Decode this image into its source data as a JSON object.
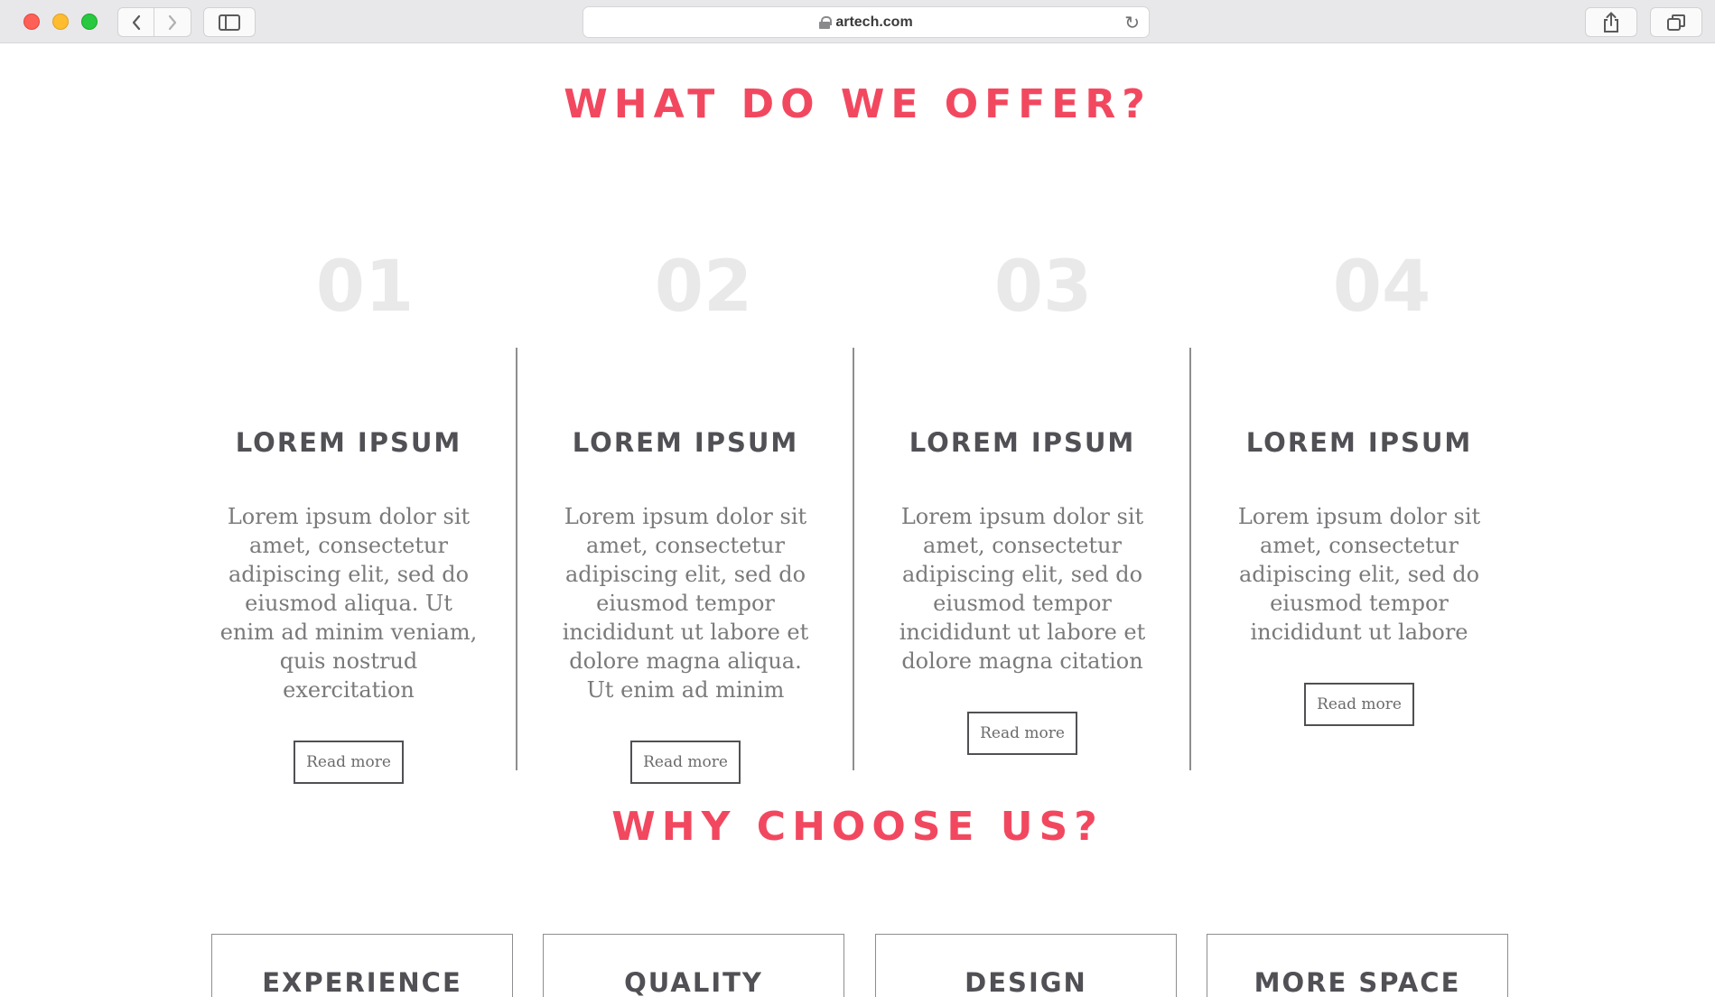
{
  "browser": {
    "url": "artech.com"
  },
  "offer": {
    "title": "WHAT DO WE OFFER?",
    "items": [
      {
        "number": "01",
        "title": "LOREM IPSUM",
        "text": "Lorem ipsum dolor sit amet, consectetur adipiscing elit, sed do eiusmod aliqua. Ut enim ad minim veniam, quis nostrud exercitation",
        "button": "Read more"
      },
      {
        "number": "02",
        "title": "LOREM IPSUM",
        "text": "Lorem ipsum dolor sit amet, consectetur adipiscing elit, sed do eiusmod tempor incididunt ut labore et dolore magna aliqua. Ut enim ad minim",
        "button": "Read more"
      },
      {
        "number": "03",
        "title": "LOREM IPSUM",
        "text": "Lorem ipsum dolor sit amet, consectetur adipiscing elit, sed do eiusmod tempor incididunt ut labore et dolore magna citation",
        "button": "Read more"
      },
      {
        "number": "04",
        "title": "LOREM IPSUM",
        "text": "Lorem ipsum dolor sit amet, consectetur adipiscing elit, sed do eiusmod tempor incididunt ut labore",
        "button": "Read more"
      }
    ]
  },
  "why": {
    "title": "WHY CHOOSE US?",
    "features": [
      "EXPERIENCE",
      "QUALITY",
      "DESIGN",
      "MORE SPACE"
    ]
  },
  "colors": {
    "accent": "#f2485f",
    "heading": "#505055",
    "body_text": "#7a7a7c",
    "number": "#e9e9ea"
  },
  "icons": {
    "back": "chevron-left-icon",
    "forward": "chevron-right-icon",
    "sidebar": "sidebar-icon",
    "lock": "lock-icon",
    "reload": "reload-icon",
    "share": "share-icon",
    "tabs": "tabs-icon"
  }
}
